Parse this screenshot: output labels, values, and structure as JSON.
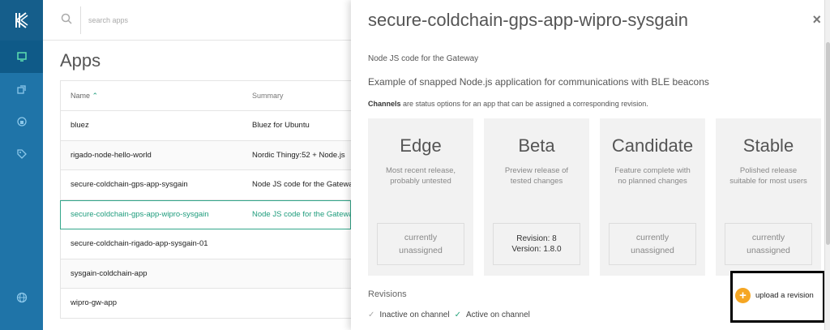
{
  "sidebar": {
    "logo_icon": "rigado-logo-icon",
    "items": [
      {
        "icon": "monitor-icon",
        "active": true
      },
      {
        "icon": "devices-icon",
        "active": false
      },
      {
        "icon": "gateway-icon",
        "active": false
      },
      {
        "icon": "tag-icon",
        "active": false
      },
      {
        "icon": "globe-icon",
        "active": false
      }
    ]
  },
  "search": {
    "placeholder": "search apps"
  },
  "main": {
    "title": "Apps",
    "columns": {
      "name": "Name",
      "summary": "Summary"
    },
    "rows": [
      {
        "name": "bluez",
        "summary": "Bluez for Ubuntu"
      },
      {
        "name": "rigado-node-hello-world",
        "summary": "Nordic Thingy:52 + Node.js"
      },
      {
        "name": "secure-coldchain-gps-app-sysgain",
        "summary": "Node JS code for the Gateway"
      },
      {
        "name": "secure-coldchain-gps-app-wipro-sysgain",
        "summary": "Node JS code for the Gateway",
        "selected": true
      },
      {
        "name": "secure-coldchain-rigado-app-sysgain-01",
        "summary": ""
      },
      {
        "name": "sysgain-coldchain-app",
        "summary": ""
      },
      {
        "name": "wipro-gw-app",
        "summary": ""
      }
    ]
  },
  "panel": {
    "title": "secure-coldchain-gps-app-wipro-sysgain",
    "close_label": "×",
    "summary": "Node JS code for the Gateway",
    "description": "Example of snapped Node.js application for communications with BLE beacons",
    "channels_note_bold": "Channels",
    "channels_note_rest": " are status options for an app that can be assigned a corresponding revision.",
    "channels": [
      {
        "name": "Edge",
        "desc_line1": "Most recent release,",
        "desc_line2": "probably untested",
        "rev_line1": "currently",
        "rev_line2": "unassigned",
        "assigned": false
      },
      {
        "name": "Beta",
        "desc_line1": "Preview release of",
        "desc_line2": "tested changes",
        "rev_line1": "Revision: 8",
        "rev_line2": "Version: 1.8.0",
        "assigned": true
      },
      {
        "name": "Candidate",
        "desc_line1": "Feature complete with",
        "desc_line2": "no planned changes",
        "rev_line1": "currently",
        "rev_line2": "unassigned",
        "assigned": false
      },
      {
        "name": "Stable",
        "desc_line1": "Polished release",
        "desc_line2": "suitable for most users",
        "rev_line1": "currently",
        "rev_line2": "unassigned",
        "assigned": false
      }
    ],
    "revisions_label": "Revisions",
    "legend_inactive": "Inactive on channel",
    "legend_active": "Active on channel",
    "upload_label": "upload a revision"
  },
  "colors": {
    "sidebar": "#1f74a8",
    "accent_green": "#1e9c7c",
    "upload_orange": "#f5a623"
  }
}
